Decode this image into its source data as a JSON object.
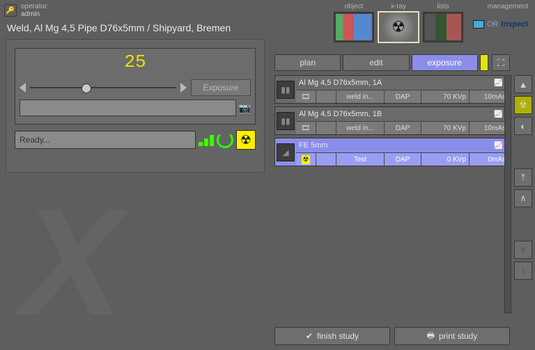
{
  "operator": {
    "label": "operator:",
    "name": "admin"
  },
  "title": "Weld, Al Mg 4,5 Pipe D76x5mm / Shipyard, Bremen",
  "nav": {
    "object": "object",
    "xray": "x-ray",
    "lists": "lists",
    "management": "management"
  },
  "brand": {
    "or": "OR",
    "inspect": "Inspect"
  },
  "display": {
    "value": "25",
    "exposure_btn": "Exposure"
  },
  "status": {
    "text": "Ready..."
  },
  "tabs": {
    "plan": "plan",
    "edit": "edit",
    "exposure": "exposure"
  },
  "items": [
    {
      "title": "Al Mg 4,5 D76x5mm, 1A",
      "name": "weld in...",
      "dap": "DAP",
      "kvp": "70 KVp",
      "mas": "10mAs",
      "selected": false,
      "icon": "film"
    },
    {
      "title": "Al Mg 4,5 D76x5mm, 1B",
      "name": "weld in...",
      "dap": "DAP",
      "kvp": "70 KVp",
      "mas": "10mAs",
      "selected": false,
      "icon": "film"
    },
    {
      "title": "FE 5mm",
      "name": "Test",
      "dap": "DAP",
      "kvp": "0 KVp",
      "mas": "0mAs",
      "selected": true,
      "icon": "rad"
    }
  ],
  "bottom": {
    "finish": "finish study",
    "print": "print study"
  }
}
